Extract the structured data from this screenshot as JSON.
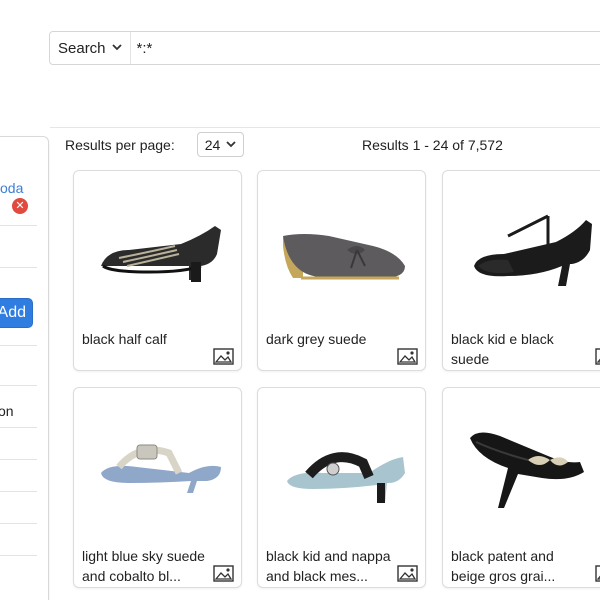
{
  "search": {
    "type_label": "Search",
    "query": "*:*"
  },
  "sidebar": {
    "link_text": "oda",
    "remove_label": "×",
    "add_label": "Add",
    "text_item": "on"
  },
  "results": {
    "per_page_label": "Results per page:",
    "per_page_value": "24",
    "count_label": "Results  1 - 24 of 7,572"
  },
  "items": [
    {
      "title": "black half calf",
      "icon": "image-icon"
    },
    {
      "title": "dark grey suede",
      "icon": "image-icon"
    },
    {
      "title": "black kid e black suede",
      "icon": "image-icon"
    },
    {
      "title": "light blue sky suede and cobalto bl...",
      "icon": "image-icon"
    },
    {
      "title": "black kid and nappa and black mes...",
      "icon": "image-icon"
    },
    {
      "title": "black patent and beige gros grai...",
      "icon": "image-icon"
    }
  ],
  "colors": {
    "accent": "#2f7de1",
    "link": "#3a7fd3",
    "remove": "#e04a3f"
  }
}
